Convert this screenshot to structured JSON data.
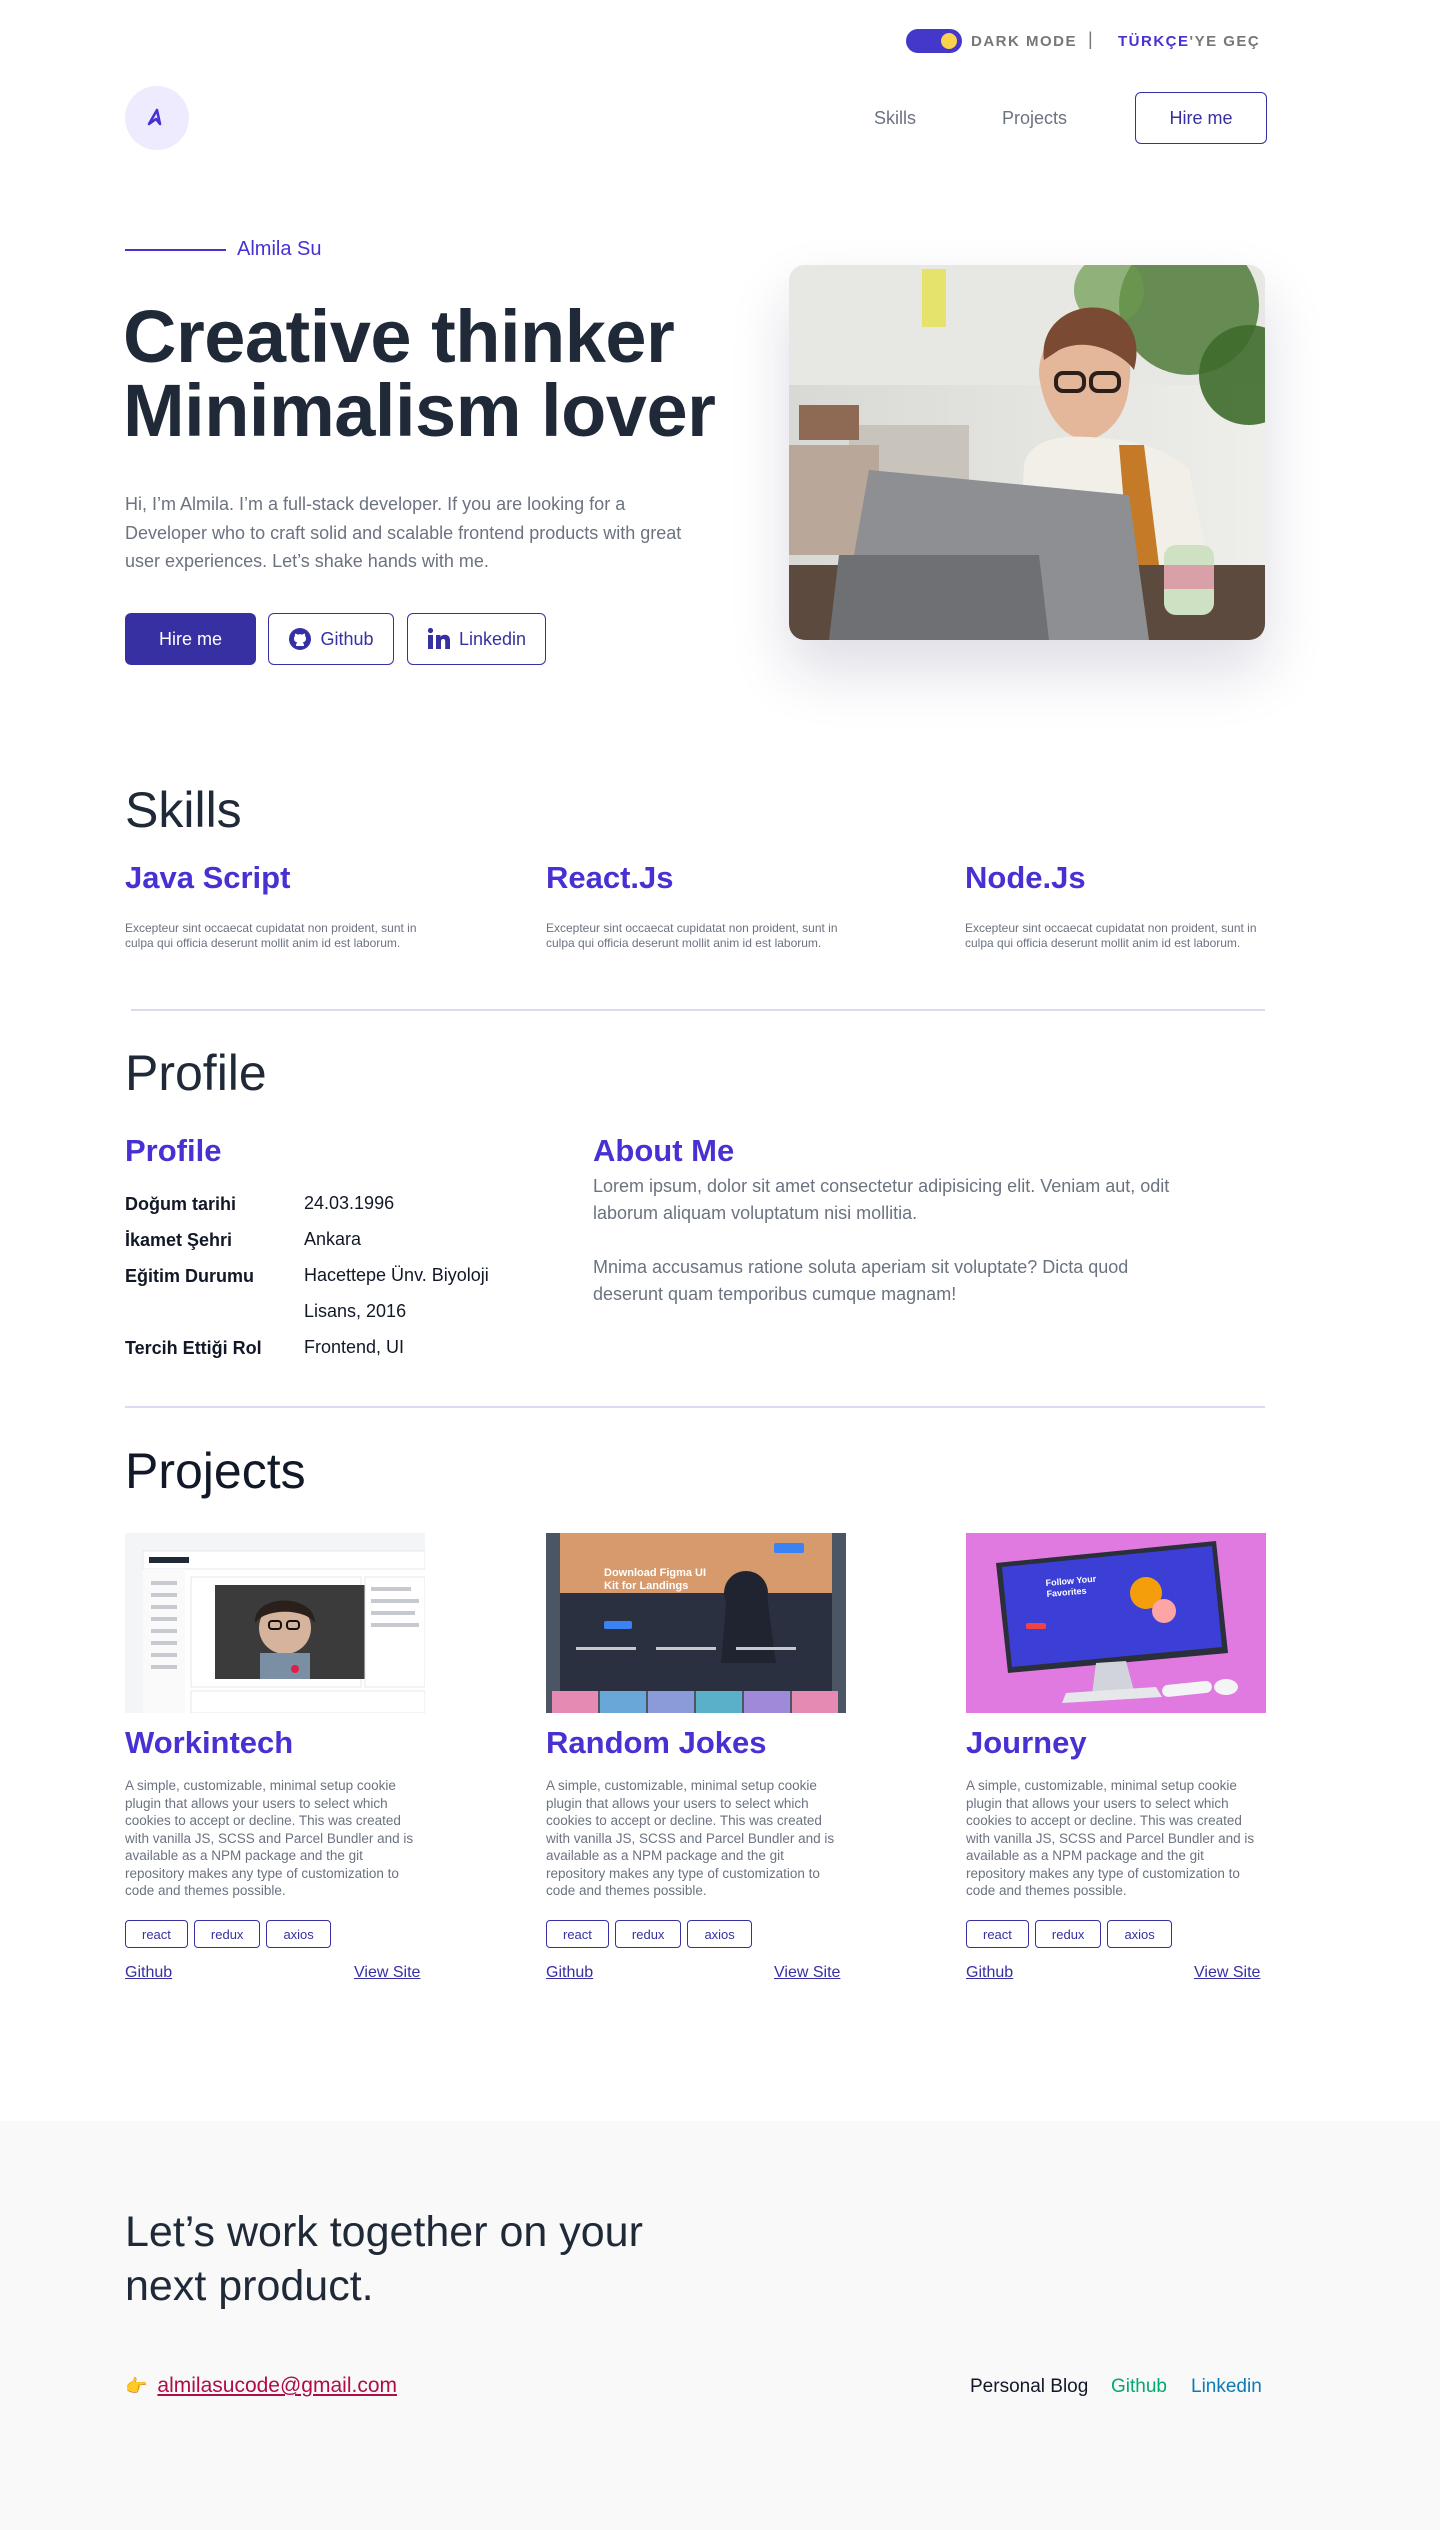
{
  "topbar": {
    "dark_mode_label": "DARK MODE",
    "separator": "|",
    "lang_accent": "TÜRKÇE",
    "lang_rest": "'YE GEÇ"
  },
  "nav": {
    "skills": "Skills",
    "projects": "Projects",
    "hire": "Hire me"
  },
  "hero": {
    "name": "Almila Su",
    "title_line1": "Creative thinker",
    "title_line2": "Minimalism lover",
    "description": "Hi, I’m Almila. I’m a full-stack developer. If you are looking for a Developer who to craft solid and scalable frontend products with great user experiences. Let’s shake hands with me.",
    "buttons": {
      "hire": "Hire me",
      "github": "Github",
      "linkedin": "Linkedin"
    }
  },
  "skills": {
    "heading": "Skills",
    "items": [
      {
        "title": "Java Script",
        "desc": "Excepteur sint occaecat cupidatat non proident, sunt in culpa qui officia deserunt mollit anim id est laborum."
      },
      {
        "title": "React.Js",
        "desc": "Excepteur sint occaecat cupidatat non proident, sunt in culpa qui officia deserunt mollit anim id est laborum."
      },
      {
        "title": "Node.Js",
        "desc": "Excepteur sint occaecat cupidatat non proident, sunt in culpa qui officia deserunt mollit anim id est laborum."
      }
    ]
  },
  "profile": {
    "heading": "Profile",
    "sub_heading": "Profile",
    "rows": [
      {
        "label": "Doğum tarihi",
        "value": "24.03.1996"
      },
      {
        "label": "İkamet Şehri",
        "value": "Ankara"
      },
      {
        "label": "Eğitim Durumu",
        "value": "Hacettepe Ünv.  Biyoloji Lisans, 2016"
      },
      {
        "label": "Tercih Ettiği Rol",
        "value": "Frontend, UI"
      }
    ],
    "about_heading": "About Me",
    "about_p1": "Lorem ipsum, dolor sit amet consectetur adipisicing elit. Veniam aut, odit laborum aliquam voluptatum nisi mollitia.",
    "about_p2": "Mnima accusamus ratione soluta aperiam sit voluptate? Dicta quod deserunt quam temporibus cumque magnam!"
  },
  "projects": {
    "heading": "Projects",
    "items": [
      {
        "title": "Workintech",
        "desc": "A simple, customizable, minimal setup cookie plugin that allows your users to select which cookies to accept or decline. This was created with vanilla JS, SCSS and Parcel Bundler and is available as a NPM package and the git repository makes any type of customization to code and themes possible.",
        "tags": [
          "react",
          "redux",
          "axios"
        ],
        "github": "Github",
        "view": "View Site"
      },
      {
        "title": "Random Jokes",
        "desc": "A simple, customizable, minimal setup cookie plugin that allows your users to select which cookies to accept or decline. This was created with vanilla JS, SCSS and Parcel Bundler and is available as a NPM package and the git repository makes any type of customization to code and themes possible.",
        "tags": [
          "react",
          "redux",
          "axios"
        ],
        "github": "Github",
        "view": "View Site",
        "image_text": "Download Figma UI Kit for Landings"
      },
      {
        "title": "Journey",
        "desc": "A simple, customizable, minimal setup cookie plugin that allows your users to select which cookies to accept or decline. This was created with vanilla JS, SCSS and Parcel Bundler and is available as a NPM package and the git repository makes any type of customization to code and themes possible.",
        "tags": [
          "react",
          "redux",
          "axios"
        ],
        "github": "Github",
        "view": "View Site",
        "image_text": "Follow Your Favorites"
      }
    ]
  },
  "footer": {
    "title": "Let’s work together on your next product.",
    "email_icon": "👉",
    "email": "almilasucode@gmail.com",
    "links": {
      "blog": "Personal Blog",
      "github": "Github",
      "linkedin": "Linkedin"
    }
  },
  "colors": {
    "accent": "#4731d3",
    "primary_button": "#3730a3",
    "text_dark": "#1f2937",
    "muted": "#6b7280",
    "email": "#af0c48",
    "footer_github": "#00ab6b",
    "footer_linkedin": "#0a7bb5"
  }
}
